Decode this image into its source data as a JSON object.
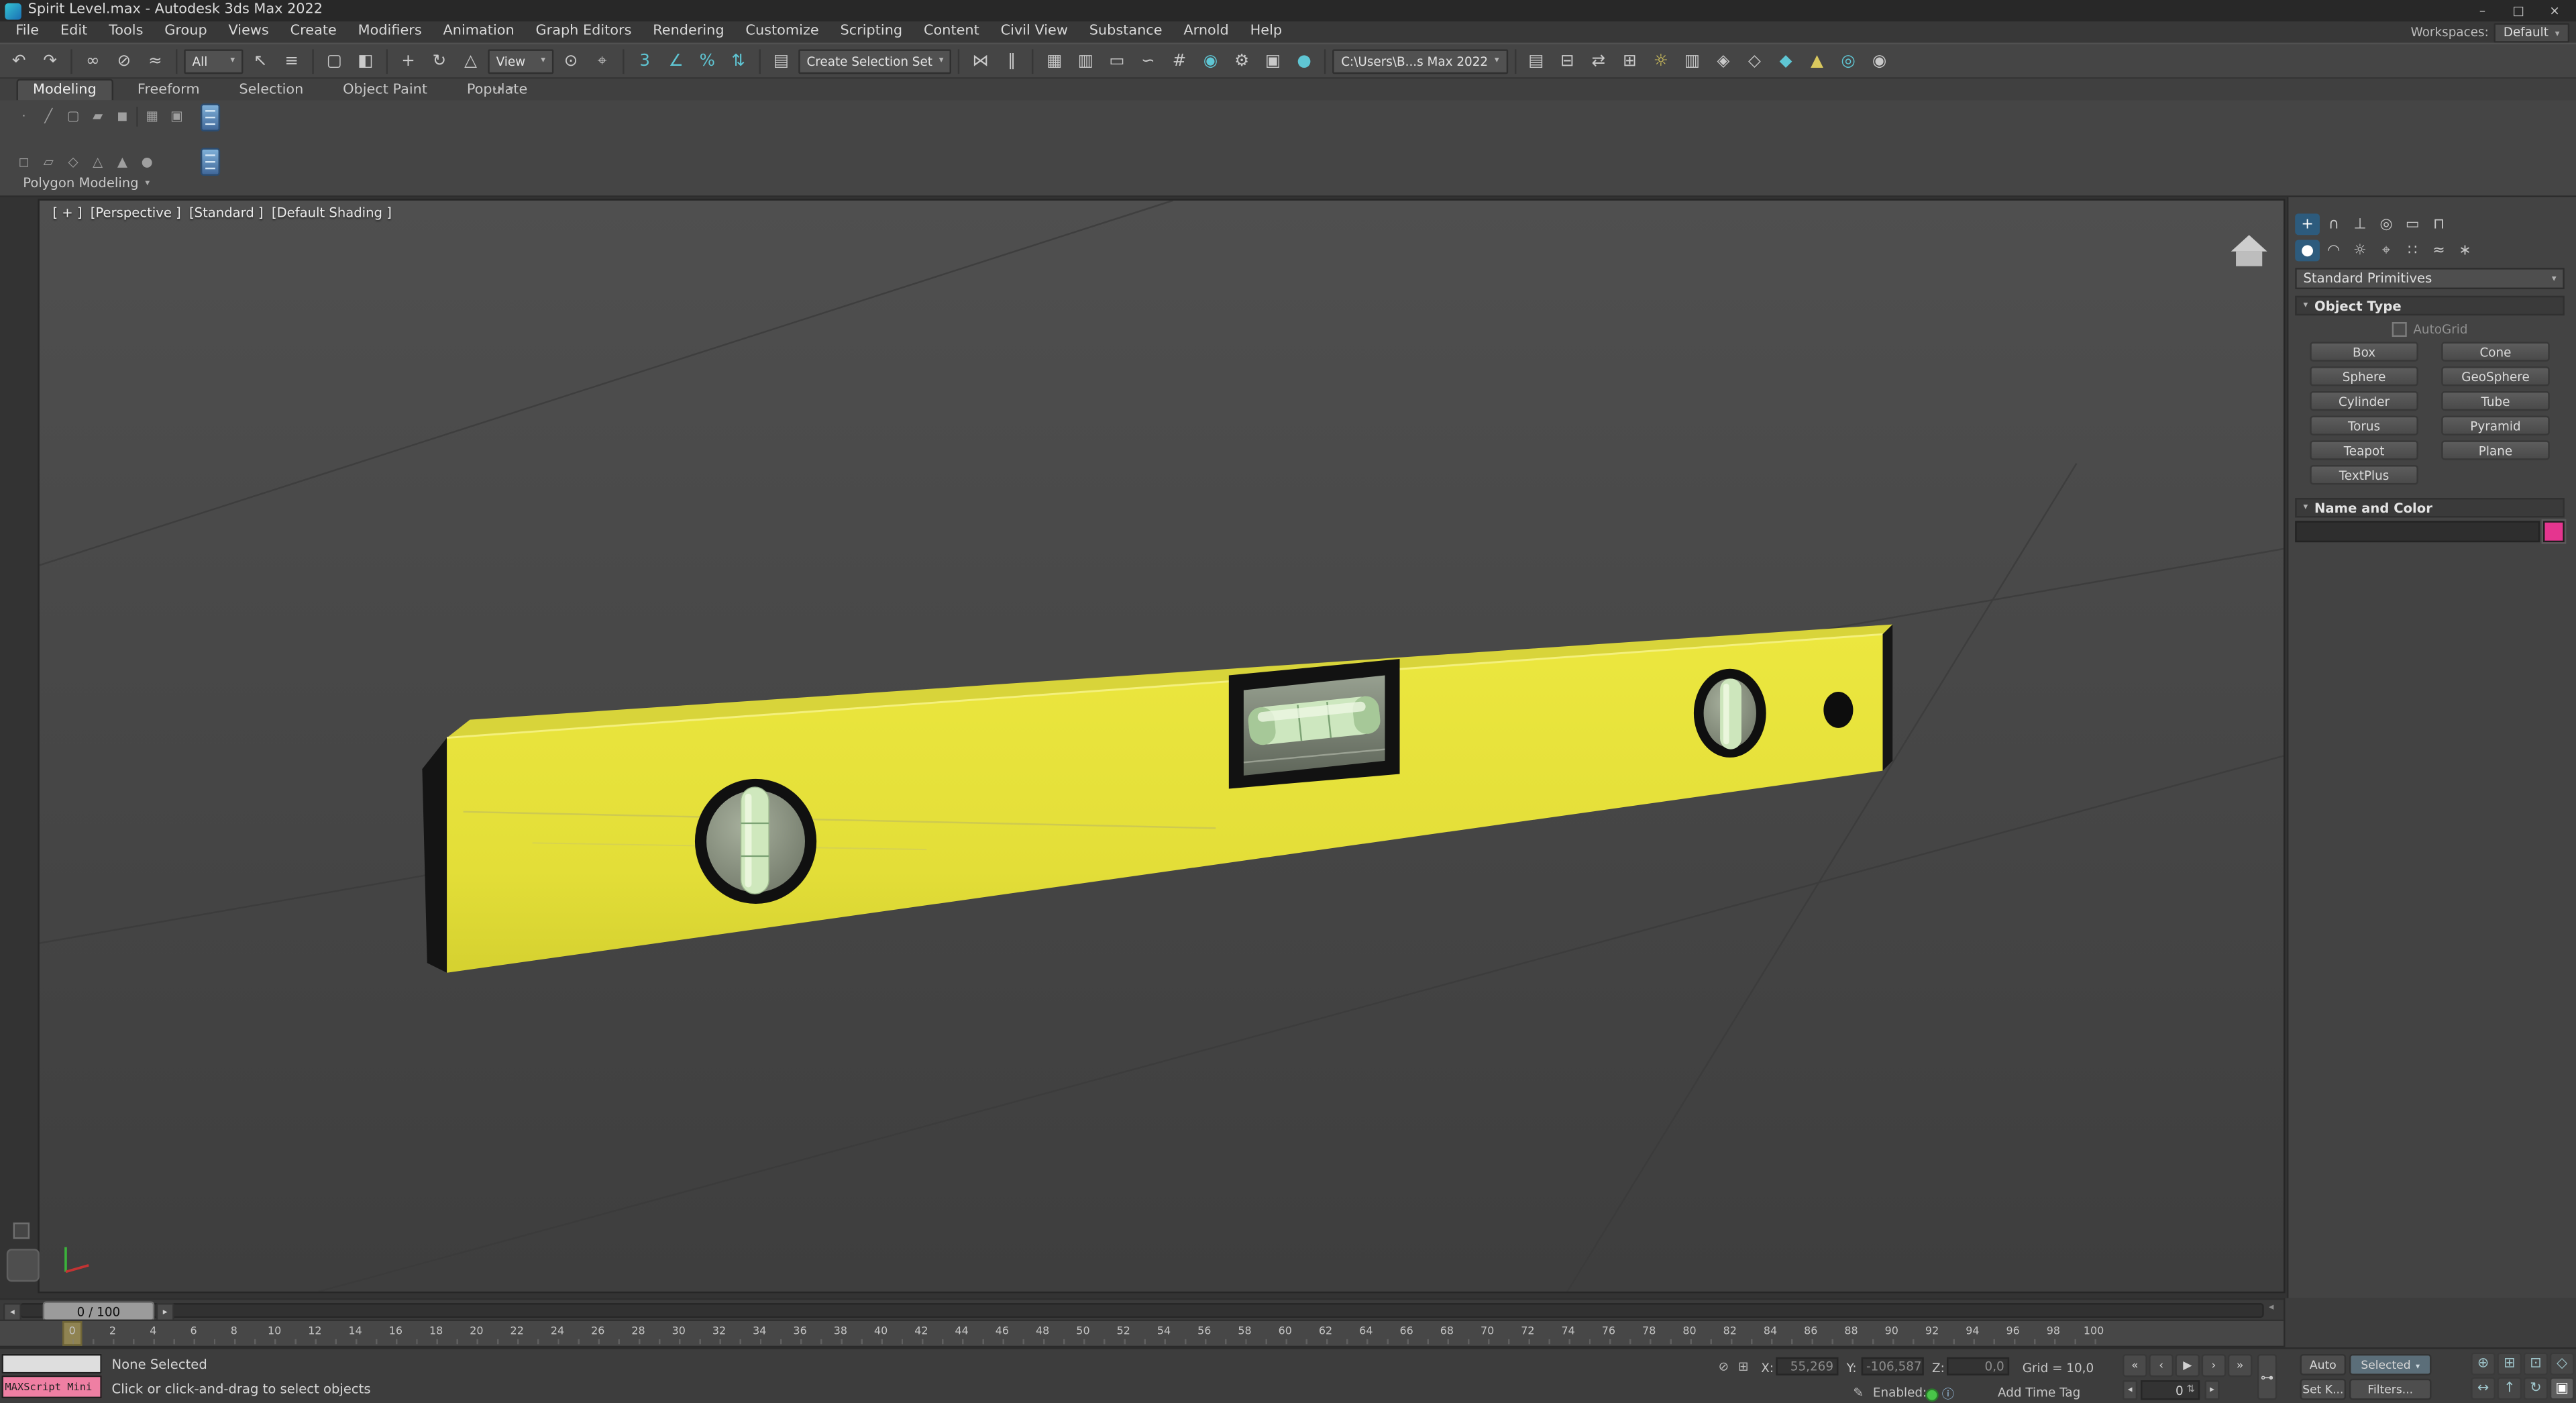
{
  "app": {
    "titlebar": {
      "title": "Spirit Level.max - Autodesk 3ds Max 2022",
      "window_buttons": {
        "minimize": "–",
        "maximize": "□",
        "close": "×"
      },
      "workspaces_label": "Workspaces:",
      "workspaces_value": "Default"
    },
    "icons": {
      "caret_down": "▾",
      "step_left": "◂",
      "step_right": "▸",
      "lock": "⊘",
      "absolute_mode": "⊞",
      "pencil": "✎",
      "info": "ⓘ",
      "key": "⊶",
      "frame_spinner": "⇅",
      "dots": "∙∙"
    },
    "menus": [
      {
        "name": "menu-file",
        "label": "File"
      },
      {
        "name": "menu-edit",
        "label": "Edit"
      },
      {
        "name": "menu-tools",
        "label": "Tools"
      },
      {
        "name": "menu-group",
        "label": "Group"
      },
      {
        "name": "menu-views",
        "label": "Views"
      },
      {
        "name": "menu-create",
        "label": "Create"
      },
      {
        "name": "menu-modifiers",
        "label": "Modifiers"
      },
      {
        "name": "menu-animation",
        "label": "Animation"
      },
      {
        "name": "menu-graph-editors",
        "label": "Graph Editors"
      },
      {
        "name": "menu-rendering",
        "label": "Rendering"
      },
      {
        "name": "menu-customize",
        "label": "Customize"
      },
      {
        "name": "menu-scripting",
        "label": "Scripting"
      },
      {
        "name": "menu-content",
        "label": "Content"
      },
      {
        "name": "menu-civil-view",
        "label": "Civil View"
      },
      {
        "name": "menu-substance",
        "label": "Substance"
      },
      {
        "name": "menu-arnold",
        "label": "Arnold"
      },
      {
        "name": "menu-help",
        "label": "Help"
      }
    ],
    "toolbar": {
      "icons": [
        {
          "name": "undo-icon",
          "glyph": "↶"
        },
        {
          "name": "redo-icon",
          "glyph": "↷"
        },
        {
          "cls": "sep",
          "ia": false
        },
        {
          "name": "select-and-link-icon",
          "glyph": "∞"
        },
        {
          "name": "unlink-selection-icon",
          "glyph": "⊘"
        },
        {
          "name": "bind-to-space-warp-icon",
          "glyph": "≈"
        },
        {
          "cls": "sep",
          "ia": false
        },
        {
          "name": "selection-filter-dropdown",
          "cls": "field w-all",
          "glyph": "All"
        },
        {
          "name": "select-object-icon",
          "glyph": "↖"
        },
        {
          "name": "select-by-name-icon",
          "glyph": "≡"
        },
        {
          "cls": "sep",
          "ia": false
        },
        {
          "name": "rectangular-selection-icon",
          "glyph": "▢"
        },
        {
          "name": "window-crossing-icon",
          "glyph": "◧"
        },
        {
          "cls": "sep",
          "ia": false
        },
        {
          "name": "select-and-move-icon",
          "glyph": "+"
        },
        {
          "name": "select-and-rotate-icon",
          "glyph": "↻"
        },
        {
          "name": "select-and-scale-icon",
          "glyph": "△"
        },
        {
          "name": "reference-coordinate-dropdown",
          "cls": "field w-view",
          "glyph": "View"
        },
        {
          "name": "use-pivot-center-icon",
          "glyph": "⊙"
        },
        {
          "name": "select-and-place-icon",
          "glyph": "⌖"
        },
        {
          "cls": "sep",
          "ia": false
        },
        {
          "name": "snaps-toggle-icon",
          "cls": "teal",
          "glyph": "3"
        },
        {
          "name": "angle-snap-icon",
          "cls": "teal",
          "glyph": "∠"
        },
        {
          "name": "percent-snap-icon",
          "cls": "teal",
          "glyph": "%"
        },
        {
          "name": "spinner-snap-icon",
          "cls": "teal",
          "glyph": "⇅"
        },
        {
          "cls": "sep",
          "ia": false
        },
        {
          "name": "edit-named-selections-icon",
          "glyph": "▤"
        },
        {
          "name": "selection-set-dropdown",
          "cls": "field w-sset",
          "glyph": "Create Selection Set"
        },
        {
          "cls": "sep",
          "ia": false
        },
        {
          "name": "mirror-icon",
          "glyph": "⋈"
        },
        {
          "name": "align-icon",
          "glyph": "∥"
        },
        {
          "cls": "sep",
          "ia": false
        },
        {
          "name": "scene-explorer-icon",
          "glyph": "▦"
        },
        {
          "name": "layer-explorer-icon",
          "glyph": "▥"
        },
        {
          "name": "ribbon-toggle-icon",
          "glyph": "▭"
        },
        {
          "name": "curve-editor-icon",
          "glyph": "∽"
        },
        {
          "name": "schematic-view-icon",
          "glyph": "#"
        },
        {
          "name": "material-editor-icon",
          "cls": "teal",
          "glyph": "◉"
        },
        {
          "name": "render-setup-icon",
          "glyph": "⚙"
        },
        {
          "name": "rendered-frame-icon",
          "glyph": "▣"
        },
        {
          "name": "render-production-icon",
          "cls": "teal",
          "glyph": "●"
        },
        {
          "cls": "sep",
          "ia": false
        },
        {
          "name": "project-folder-field",
          "cls": "field w-path",
          "glyph": "C:\\Users\\B...s Max 2022"
        },
        {
          "cls": "sep",
          "ia": false
        },
        {
          "name": "project-folder-icon",
          "glyph": "▤"
        },
        {
          "name": "asset-tracking-icon",
          "glyph": "⊟"
        },
        {
          "name": "data-exchange-icon",
          "glyph": "⇄"
        },
        {
          "name": "batch-render-icon",
          "glyph": "⊞"
        },
        {
          "name": "light-lister-icon",
          "cls": "yellow",
          "glyph": "☼"
        },
        {
          "name": "layer-manager-icon",
          "glyph": "▥"
        },
        {
          "name": "scene-states-icon",
          "glyph": "◈"
        },
        {
          "name": "civil-view-icon",
          "glyph": "◇"
        },
        {
          "name": "substance-icon",
          "cls": "teal",
          "glyph": "◆"
        },
        {
          "name": "arnold-light-icon",
          "cls": "yellow",
          "glyph": "▲"
        },
        {
          "name": "render-preview-icon",
          "cls": "teal",
          "glyph": "◎"
        },
        {
          "name": "visibility-icon",
          "glyph": "◉"
        }
      ]
    },
    "ribbon": {
      "tabs": [
        {
          "name": "ribbon-tab-modeling",
          "label": "Modeling",
          "active": true
        },
        {
          "name": "ribbon-tab-freeform",
          "label": "Freeform"
        },
        {
          "name": "ribbon-tab-selection",
          "label": "Selection"
        },
        {
          "name": "ribbon-tab-object-paint",
          "label": "Object Paint"
        },
        {
          "name": "ribbon-tab-populate",
          "label": "Populate"
        }
      ],
      "panel_label": "Polygon Modeling",
      "tool_icons_row1": [
        {
          "name": "vertex-mode-icon",
          "glyph": "·"
        },
        {
          "name": "edge-mode-icon",
          "glyph": "╱"
        },
        {
          "name": "border-mode-icon",
          "glyph": "▢"
        },
        {
          "name": "polygon-mode-icon",
          "glyph": "▰"
        },
        {
          "name": "element-mode-icon",
          "glyph": "◼"
        },
        {
          "cls": "sep",
          "ia": false
        },
        {
          "name": "preserve-uvs-icon",
          "glyph": "▦"
        },
        {
          "name": "tweak-icon",
          "glyph": "▣"
        }
      ],
      "tool_icons_row2": [
        {
          "name": "collapse-icon",
          "glyph": "◻"
        },
        {
          "name": "generate-topology-icon",
          "glyph": "▱"
        },
        {
          "name": "symmetry-tools-icon",
          "glyph": "◇"
        },
        {
          "name": "align-x-icon",
          "glyph": "△"
        },
        {
          "name": "make-planar-icon",
          "glyph": "▲"
        },
        {
          "name": "relax-icon",
          "glyph": "●"
        }
      ]
    },
    "viewport": {
      "labels": [
        {
          "name": "viewport-general-menu",
          "label": "[ + ]"
        },
        {
          "name": "viewport-pov-menu",
          "label": "[Perspective ]"
        },
        {
          "name": "viewport-standard-menu",
          "label": "[Standard ]"
        },
        {
          "name": "viewport-shading-menu",
          "label": "[Default Shading ]"
        }
      ]
    },
    "command_panel": {
      "tabs": [
        {
          "name": "create-tab-icon",
          "glyph": "+",
          "active": true
        },
        {
          "name": "modify-tab-icon",
          "glyph": "∩"
        },
        {
          "name": "hierarchy-tab-icon",
          "glyph": "⊥"
        },
        {
          "name": "motion-tab-icon",
          "glyph": "◎"
        },
        {
          "name": "display-tab-icon",
          "glyph": "▭"
        },
        {
          "name": "utilities-tab-icon",
          "glyph": "⊓"
        }
      ],
      "categories": [
        {
          "name": "geometry-category-icon",
          "glyph": "●",
          "active": true
        },
        {
          "name": "shapes-category-icon",
          "glyph": "◠"
        },
        {
          "name": "lights-category-icon",
          "glyph": "☼"
        },
        {
          "name": "cameras-category-icon",
          "glyph": "⌖"
        },
        {
          "name": "helpers-category-icon",
          "glyph": "∷"
        },
        {
          "name": "space-warps-category-icon",
          "glyph": "≈"
        },
        {
          "name": "systems-category-icon",
          "glyph": "∗"
        }
      ],
      "dropdown_value": "Standard Primitives",
      "object_type_title": "Object Type",
      "autogrid_label": "AutoGrid",
      "primitive_buttons": [
        {
          "name": "primitive-box-button",
          "label": "Box"
        },
        {
          "name": "primitive-cone-button",
          "label": "Cone"
        },
        {
          "name": "primitive-sphere-button",
          "label": "Sphere"
        },
        {
          "name": "primitive-geosphere-button",
          "label": "GeoSphere"
        },
        {
          "name": "primitive-cylinder-button",
          "label": "Cylinder"
        },
        {
          "name": "primitive-tube-button",
          "label": "Tube"
        },
        {
          "name": "primitive-torus-button",
          "label": "Torus"
        },
        {
          "name": "primitive-pyramid-button",
          "label": "Pyramid"
        },
        {
          "name": "primitive-teapot-button",
          "label": "Teapot"
        },
        {
          "name": "primitive-plane-button",
          "label": "Plane"
        },
        {
          "name": "primitive-textplus-button",
          "label": "TextPlus"
        }
      ],
      "name_color_title": "Name and Color",
      "object_color": "#e5358f"
    },
    "time_slider": {
      "label": "0 / 100"
    },
    "trackbar": {
      "ticks": [
        0,
        2,
        4,
        6,
        8,
        10,
        12,
        14,
        16,
        18,
        20,
        22,
        24,
        26,
        28,
        30,
        32,
        34,
        36,
        38,
        40,
        42,
        44,
        46,
        48,
        50,
        52,
        54,
        56,
        58,
        60,
        62,
        64,
        66,
        68,
        70,
        72,
        74,
        76,
        78,
        80,
        82,
        84,
        86,
        88,
        90,
        92,
        94,
        96,
        98,
        100
      ]
    },
    "status": {
      "maxscript_label": "MAXScript Mini",
      "selection_status": "None Selected",
      "prompt": "Click or click-and-drag to select objects",
      "coords": {
        "x_label": "X:",
        "x_value": "55,269",
        "y_label": "Y:",
        "y_value": "-106,587",
        "z_label": "Z:",
        "z_value": "0,0"
      },
      "grid_label": "Grid = 10,0",
      "add_time_tag": "Add Time Tag",
      "enabled_label": "Enabled:",
      "auto_label": "Auto",
      "selected_label": "Selected",
      "set_key_label": "Set K...",
      "filters_label": "Filters...",
      "frame_value": "0",
      "playback": [
        {
          "name": "go-to-start-button",
          "glyph": "«"
        },
        {
          "name": "previous-key-button",
          "glyph": "‹"
        },
        {
          "name": "play-button",
          "glyph": "▶"
        },
        {
          "name": "next-key-button",
          "glyph": "›"
        },
        {
          "name": "go-to-end-button",
          "glyph": "»"
        }
      ],
      "nav_icons": [
        {
          "name": "zoom-icon",
          "glyph": "⊕"
        },
        {
          "name": "zoom-all-icon",
          "glyph": "⊞"
        },
        {
          "name": "zoom-extents-icon",
          "glyph": "⊡"
        },
        {
          "name": "zoom-region-icon",
          "glyph": "◇"
        },
        {
          "name": "pan-icon",
          "glyph": "↔"
        },
        {
          "name": "walk-through-icon",
          "glyph": "↑"
        },
        {
          "name": "orbit-icon",
          "glyph": "↻"
        },
        {
          "name": "maximize-viewport-icon",
          "glyph": "▣",
          "active": true
        }
      ]
    }
  }
}
